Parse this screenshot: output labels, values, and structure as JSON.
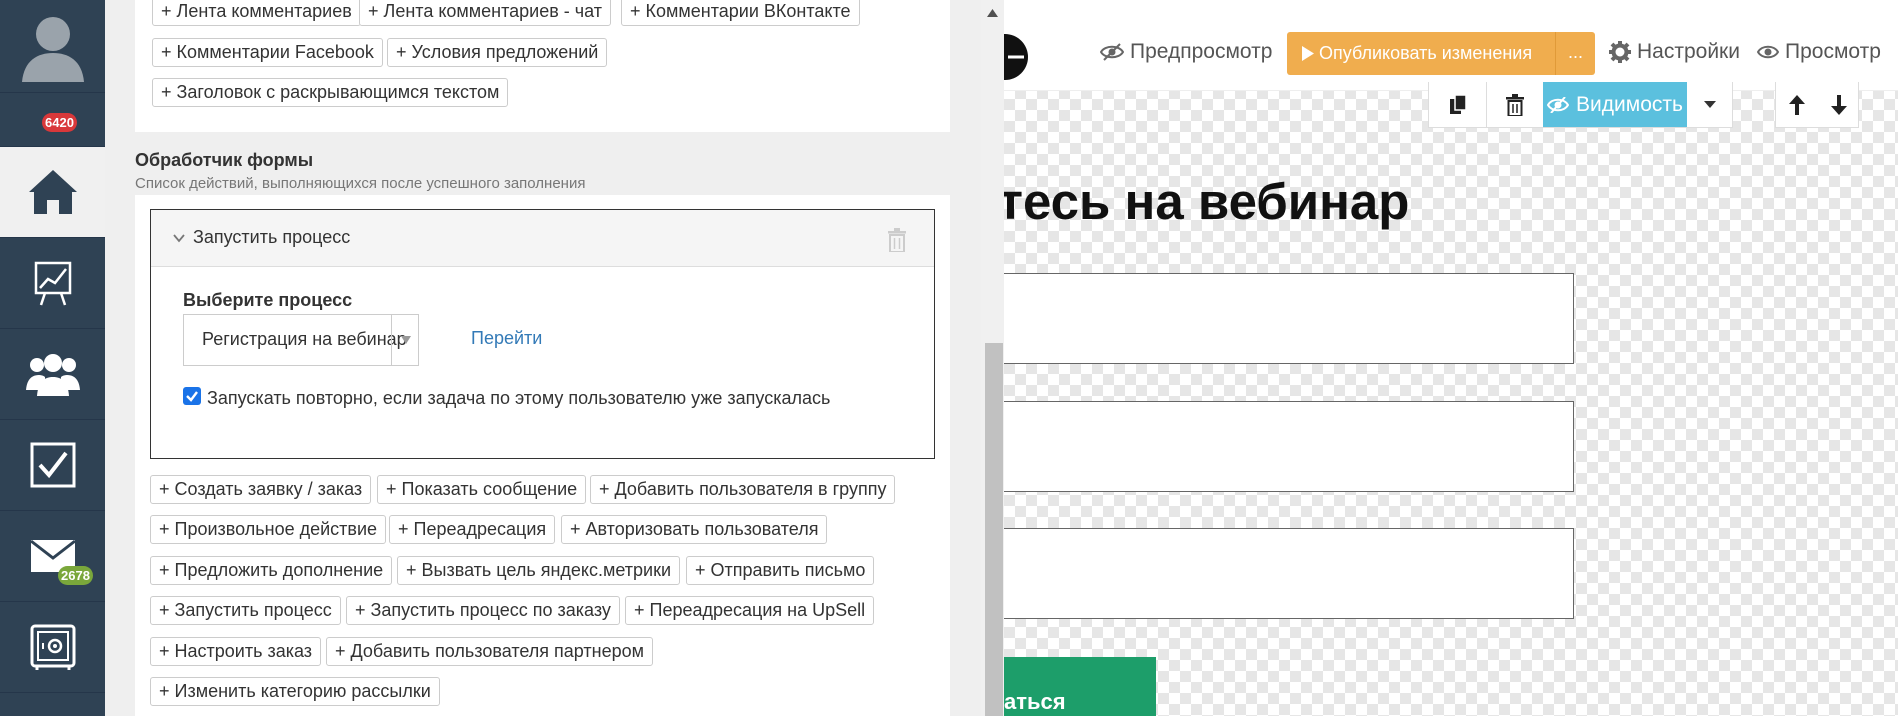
{
  "sidebar": {
    "notifications_badge": "6420",
    "mail_badge": "2678"
  },
  "panel": {
    "top_buttons": [
      "+ Лента комментариев",
      "+ Лента комментариев - чат",
      "+ Комментарии ВКонтакте",
      "+ Комментарии Facebook",
      "+ Условия предложений",
      "+ Заголовок с раскрывающимся текстом"
    ],
    "section_title": "Обработчик формы",
    "section_subtitle": "Список действий, выполняющихся после успешного заполнения",
    "action": {
      "title": "Запустить процесс",
      "select_label": "Выберите процесс",
      "select_value": "Регистрация на вебинар",
      "goto_link": "Перейти",
      "checkbox_label": "Запускать повторно, если задача по этому пользователю уже запускалась",
      "checkbox_checked": true
    },
    "action_buttons": [
      "+ Создать заявку / заказ",
      "+ Показать сообщение",
      "+ Добавить пользователя в группу",
      "+ Произвольное действие",
      "+ Переадресация",
      "+ Авторизовать пользователя",
      "+ Предложить дополнение",
      "+ Вызвать цель яндекс.метрики",
      "+ Отправить письмо",
      "+ Запустить процесс",
      "+ Запустить процесс по заказу",
      "+ Переадресация на UpSell",
      "+ Настроить заказ",
      "+ Добавить пользователя партнером",
      "+ Изменить категорию рассылки"
    ]
  },
  "editor": {
    "preview_label": "Предпросмотр",
    "publish_label": "Опубликовать изменения",
    "publish_more": "...",
    "settings_label": "Настройки",
    "view_label": "Просмотр",
    "visibility_label": "Видимость",
    "heading": "тесь на вебинар",
    "submit_label": "аться",
    "colors": {
      "publish": "#f0ad4e",
      "visibility": "#5bc0de",
      "submit": "#1d9e6a"
    }
  }
}
